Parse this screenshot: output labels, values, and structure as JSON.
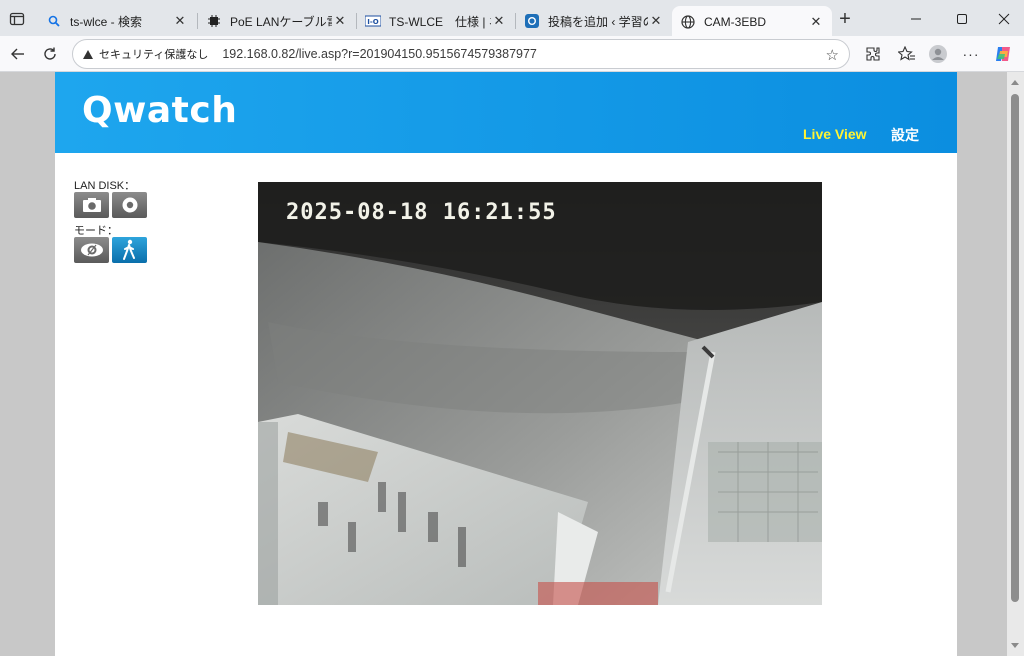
{
  "browser": {
    "tabs": [
      {
        "title": "ts-wlce - 検索",
        "icon": "search-icon",
        "active": false
      },
      {
        "title": "PoE LANケーブル電源供",
        "icon": "chip-icon",
        "active": false
      },
      {
        "title": "TS-WLCE　仕様 | ネット",
        "icon": "iodata-icon",
        "active": false
      },
      {
        "title": "投稿を追加 ‹ 学習の補助",
        "icon": "wordpress-icon",
        "active": false
      },
      {
        "title": "CAM-3EBD",
        "icon": "globe-icon",
        "active": true
      }
    ],
    "security_label": "セキュリティ保護なし",
    "url": "192.168.0.82/live.asp?r=201904150.9515674579387977"
  },
  "page": {
    "logo": "Qwatch",
    "nav": {
      "live_view": "Live View",
      "settings": "設定"
    },
    "sidebar": {
      "lan_disk_label": "LAN DISK：",
      "mode_label": "モード："
    },
    "video": {
      "timestamp": "2025-08-18  16:21:55"
    }
  },
  "colors": {
    "header_blue": "#1ea6ee",
    "live_view_yellow": "#fff534"
  }
}
